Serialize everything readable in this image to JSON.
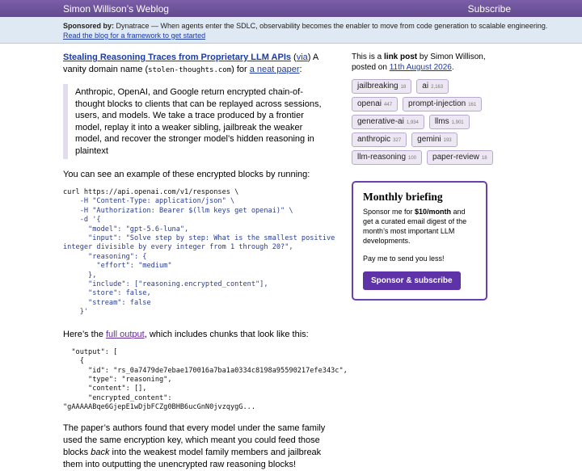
{
  "header": {
    "site_title": "Simon Willison’s Weblog",
    "subscribe_label": "Subscribe"
  },
  "sponsor": {
    "label": "Sponsored by:",
    "text": "Dynatrace — When agents enter the SDLC, observability becomes the enabler to move from code generation to scalable engineering.",
    "link": "Read the blog for a framework to get started"
  },
  "post": {
    "title": "Stealing Reasoning Traces from Proprietary LLM APIs",
    "via_open": " (",
    "via": "via",
    "intro_1": ") A vanity domain name (",
    "domain": "stolen-thoughts.com",
    "intro_2": ") for ",
    "paper_link": "a neat paper",
    "intro_3": ":",
    "quote": "Anthropic, OpenAI, and Google return encrypted chain-of-thought blocks to clients that can be replayed across sessions, users, and models. We take a trace produced by a frontier model, replay it into a weaker sibling, jailbreak the weaker model, and recover the stronger model’s hidden reasoning in plaintext",
    "p_example": "You can see an example of these encrypted blocks by running:",
    "code1": [
      "curl https://api.openai.com/v1/responses \\",
      "    -H \"Content-Type: application/json\" \\",
      "    -H \"Authorization: Bearer $(llm keys get openai)\" \\",
      "    -d '{",
      "      \"model\": \"gpt-5.6-luna\",",
      "      \"input\": \"Solve step by step: What is the smallest positive",
      "integer divisible by every integer from 1 through 20?\",",
      "      \"reasoning\": {",
      "        \"effort\": \"medium\"",
      "      },",
      "      \"include\": [\"reasoning.encrypted_content\"],",
      "      \"store\": false,",
      "      \"stream\": false",
      "    }'"
    ],
    "p_output_1": "Here’s the ",
    "output_link": "full output",
    "p_output_2": ", which includes chunks that look like this:",
    "code2": [
      "  \"output\": [",
      "    {",
      "      \"id\": \"rs_0a7479de7ebae170016a7ba1a0334c8198a95590217efe343c\",",
      "      \"type\": \"reasoning\",",
      "      \"content\": [],",
      "      \"encrypted_content\":",
      "\"gAAAAABqe6GjepE1wDjbFCZg0BHB6ucGnN0jvzqygG..."
    ],
    "p_final_1": "The paper’s authors found that every model under the same family used the same encryption key, which meant you could feed those blocks ",
    "p_final_em": "back",
    "p_final_2": " into the weakest model family members and jailbreak them into outputting the unencrypted raw reasoning blocks!"
  },
  "sidebar": {
    "meta_1": "This is a ",
    "meta_bold": "link post",
    "meta_2": " by Simon Willison, posted on ",
    "date": "11th August 2026",
    "meta_3": ".",
    "tags": [
      {
        "name": "jailbreaking",
        "count": "18"
      },
      {
        "name": "ai",
        "count": "2,163"
      },
      {
        "name": "openai",
        "count": "447"
      },
      {
        "name": "prompt-injection",
        "count": "161"
      },
      {
        "name": "generative-ai",
        "count": "1,934"
      },
      {
        "name": "llms",
        "count": "1,901"
      },
      {
        "name": "anthropic",
        "count": "327"
      },
      {
        "name": "gemini",
        "count": "193"
      },
      {
        "name": "llm-reasoning",
        "count": "100"
      },
      {
        "name": "paper-review",
        "count": "18"
      }
    ],
    "promo": {
      "title": "Monthly briefing",
      "text_1": "Sponsor me for ",
      "price": "$10/month",
      "text_2": " and get a curated email digest of the month’s most important LLM developments.",
      "ask": "Pay me to send you less!",
      "button": "Sponsor & subscribe"
    }
  }
}
